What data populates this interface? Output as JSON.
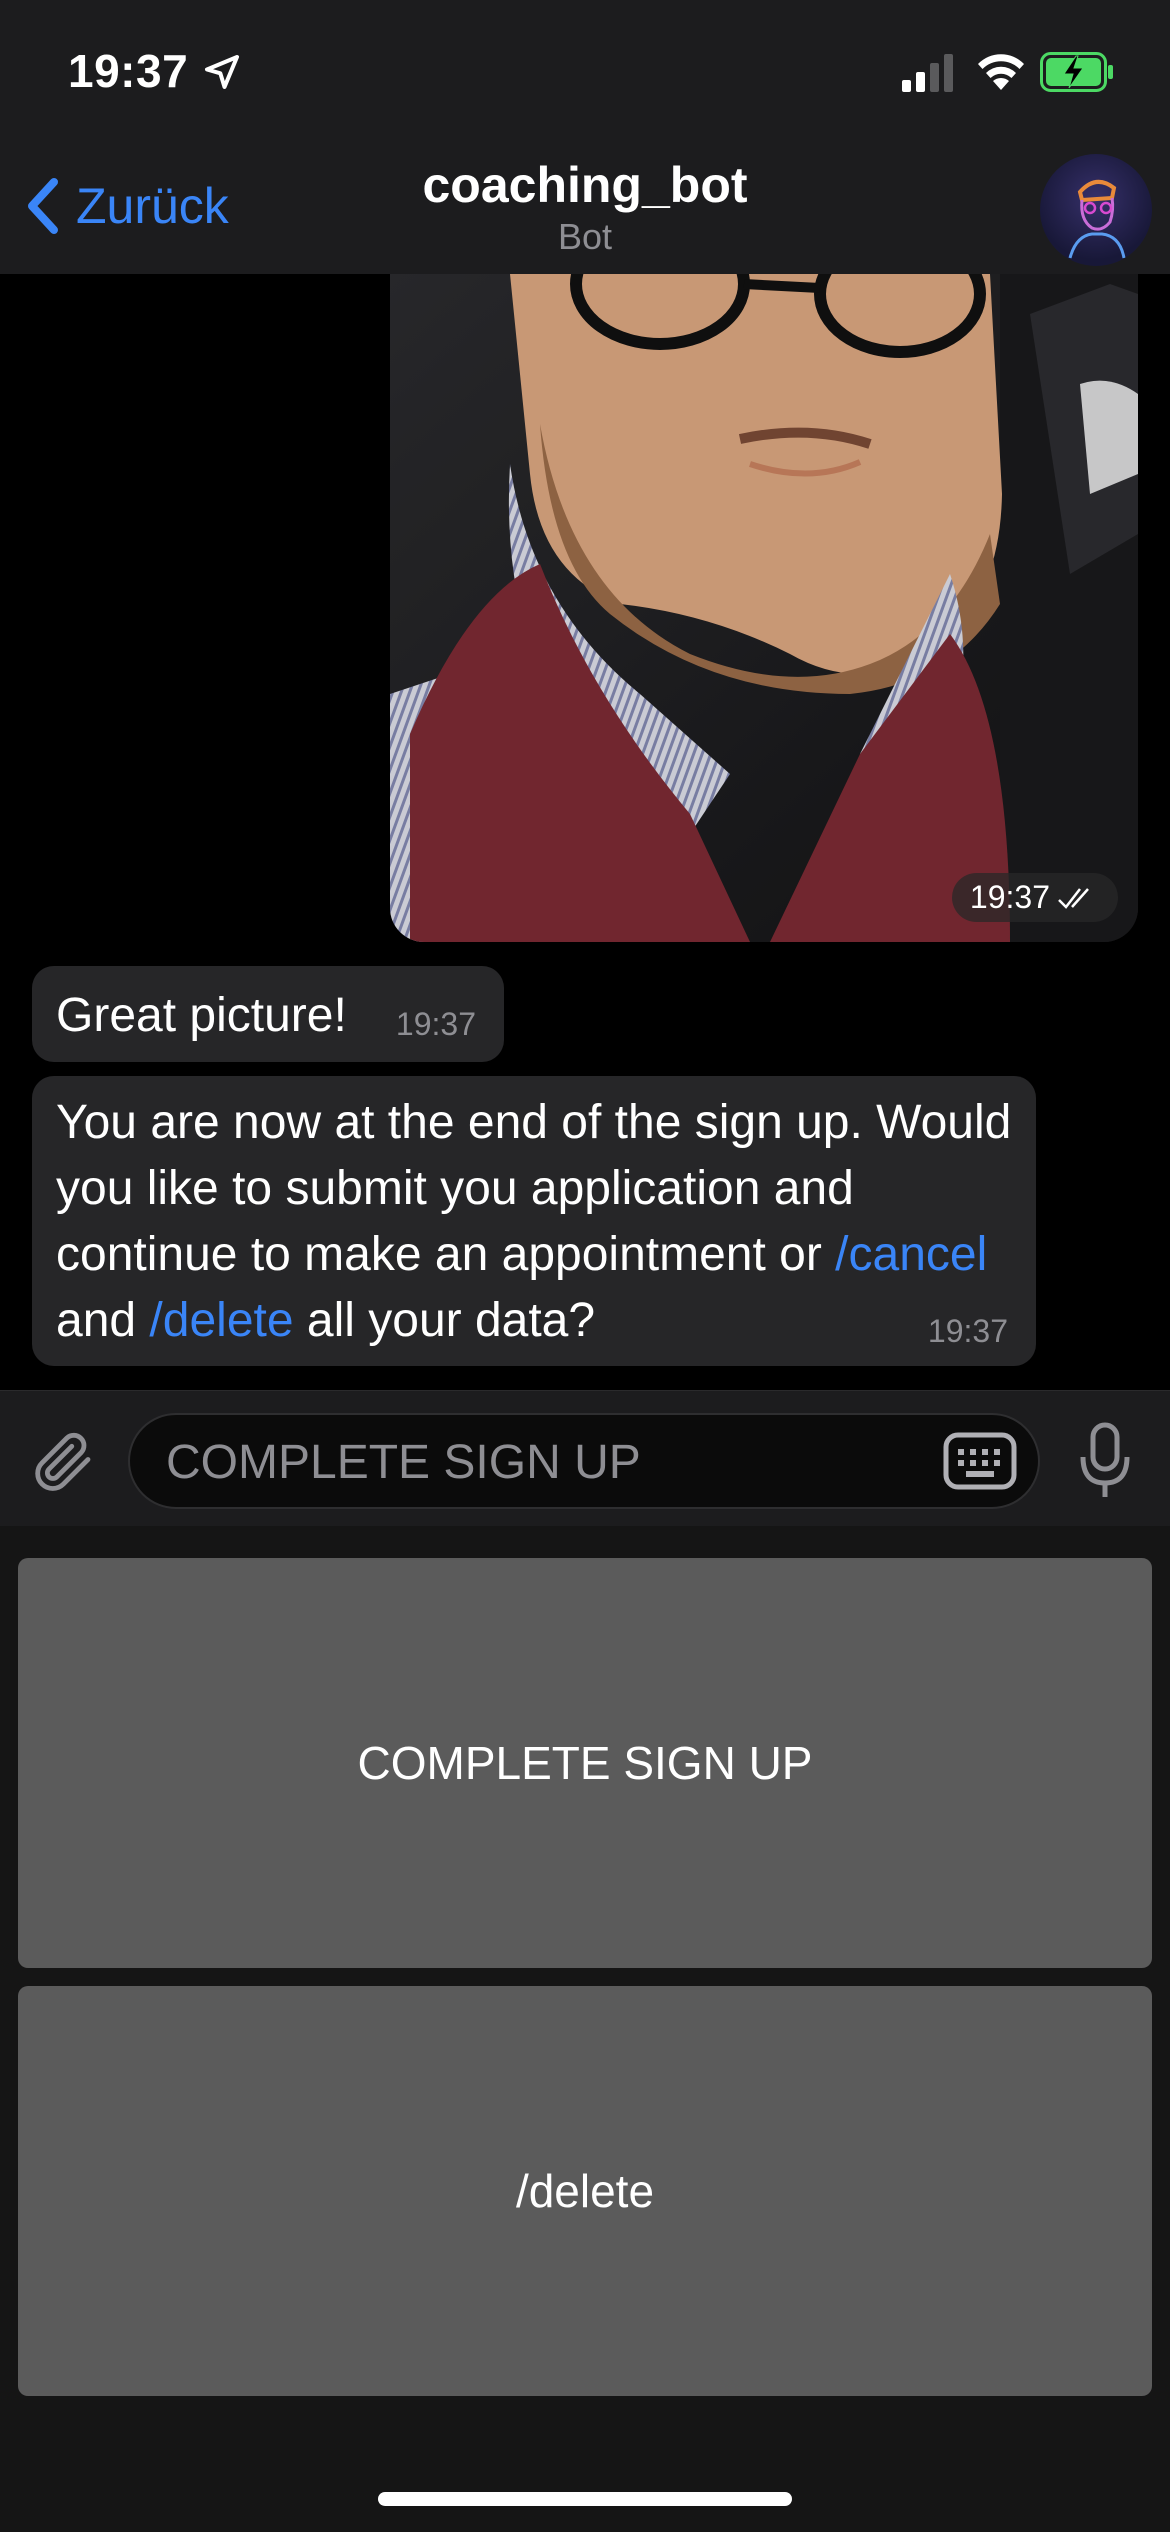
{
  "status": {
    "time": "19:37"
  },
  "nav": {
    "back_label": "Zurück",
    "title": "coaching_bot",
    "subtitle": "Bot"
  },
  "messages": {
    "photo_time": "19:37",
    "m1_text": "Great picture!",
    "m1_time": "19:37",
    "m2_line_a": "You are now at the end of the sign up. Would you like to submit you application and continue to make an appointment or ",
    "m2_cmd_cancel": "/cancel",
    "m2_mid": " and ",
    "m2_cmd_delete": "/delete",
    "m2_end": " all your data?",
    "m2_time": "19:37"
  },
  "input": {
    "placeholder": "COMPLETE SIGN UP"
  },
  "keyboard": {
    "buttons": [
      "COMPLETE SIGN UP",
      "/delete"
    ]
  },
  "colors": {
    "accent": "#3a85f7",
    "bubble": "#262628",
    "bar": "#1c1c1e",
    "keyboard_button": "#5b5b5b"
  }
}
